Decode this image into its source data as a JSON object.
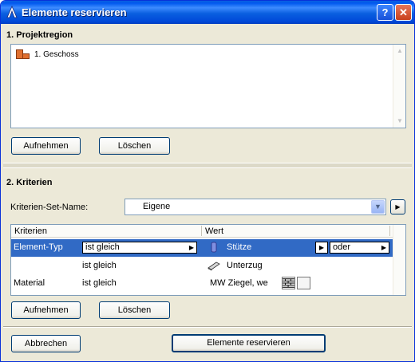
{
  "window": {
    "title": "Elemente reservieren",
    "help_glyph": "?",
    "close_glyph": "✕"
  },
  "section1": {
    "title": "1. Projektregion",
    "tree_items": [
      {
        "label": "1. Geschoss"
      }
    ],
    "add_label": "Aufnehmen",
    "delete_label": "Löschen"
  },
  "section2": {
    "title": "2. Kriterien",
    "set_name_label": "Kriterien-Set-Name:",
    "set_name_value": "Eigene",
    "table": {
      "headers": [
        "Kriterien",
        "Wert"
      ],
      "rows": [
        {
          "criterion": "Element-Typ",
          "operator": "ist gleich",
          "value": "Stütze",
          "logic": "oder",
          "selected": true
        },
        {
          "criterion": "",
          "operator": "ist gleich",
          "value": "Unterzug",
          "logic": "",
          "selected": false
        },
        {
          "criterion": "Material",
          "operator": "ist gleich",
          "value": "MW Ziegel, we",
          "logic": "",
          "selected": false
        }
      ]
    },
    "add_label": "Aufnehmen",
    "delete_label": "Löschen"
  },
  "footer": {
    "cancel_label": "Abbrechen",
    "reserve_label": "Elemente reservieren"
  },
  "colors": {
    "titlebar": "#0058ee",
    "selection": "#316ac5",
    "dialog_bg": "#ece9d8"
  }
}
